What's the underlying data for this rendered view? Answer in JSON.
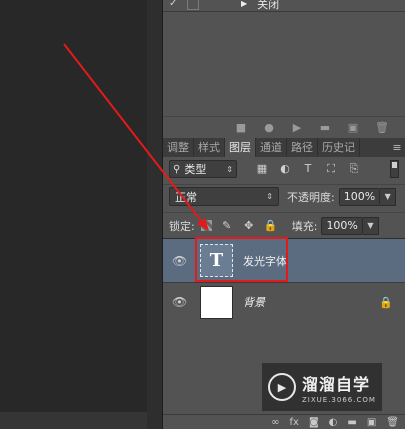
{
  "actions_panel": {
    "action_label": "关闭"
  },
  "tabs": [
    {
      "label": "调整",
      "active": false
    },
    {
      "label": "样式",
      "active": false
    },
    {
      "label": "图层",
      "active": true
    },
    {
      "label": "通道",
      "active": false
    },
    {
      "label": "路径",
      "active": false
    },
    {
      "label": "历史记",
      "active": false
    }
  ],
  "filter": {
    "kind_label": "类型"
  },
  "blend": {
    "mode": "正常",
    "opacity_label": "不透明度:",
    "opacity_value": "100%"
  },
  "lock": {
    "label": "锁定:",
    "fill_label": "填充:",
    "fill_value": "100%"
  },
  "layers": [
    {
      "name": "发光字体",
      "type": "text",
      "thumb_glyph": "T",
      "selected": true,
      "visible": true
    },
    {
      "name": "背景",
      "type": "background",
      "selected": false,
      "visible": true,
      "locked": true
    }
  ],
  "watermark": {
    "title": "溜溜自学",
    "subtitle": "ZIXUE.3066.COM"
  },
  "colors": {
    "panel_bg": "#535353",
    "selected_layer": "#5b6b80",
    "annotation_red": "#e41a1a"
  }
}
